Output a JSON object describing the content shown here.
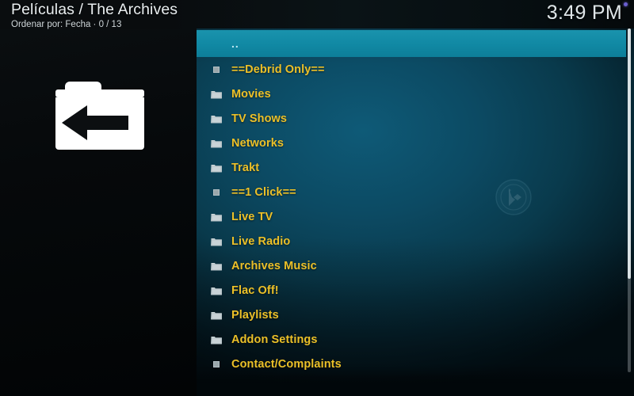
{
  "header": {
    "title": "Películas / The Archives",
    "subtitle": "Ordenar por: Fecha  ·  0 / 13",
    "clock": "3:49 PM",
    "notification_dot_color": "#6a5fd0"
  },
  "left_panel": {
    "icon_name": "parent-folder-back-icon"
  },
  "colors": {
    "highlight": "#1189a4",
    "item_text": "#ecc028",
    "selected_text": "#bfe9f4",
    "background_teal": "#0c4a63",
    "panel_dark": "#06090b"
  },
  "list": {
    "selected_index": 0,
    "items": [
      {
        "label": "..",
        "icon": "none",
        "selected": true
      },
      {
        "label": "==Debrid Only==",
        "icon": "file",
        "selected": false
      },
      {
        "label": "Movies",
        "icon": "folder",
        "selected": false
      },
      {
        "label": "TV Shows",
        "icon": "folder",
        "selected": false
      },
      {
        "label": "Networks",
        "icon": "folder",
        "selected": false
      },
      {
        "label": "Trakt",
        "icon": "folder",
        "selected": false
      },
      {
        "label": "==1 Click==",
        "icon": "file",
        "selected": false
      },
      {
        "label": "Live TV",
        "icon": "folder",
        "selected": false
      },
      {
        "label": "Live Radio",
        "icon": "folder",
        "selected": false
      },
      {
        "label": "Archives Music",
        "icon": "folder",
        "selected": false
      },
      {
        "label": "Flac Off!",
        "icon": "folder",
        "selected": false
      },
      {
        "label": "Playlists",
        "icon": "folder",
        "selected": false
      },
      {
        "label": "Addon Settings",
        "icon": "folder",
        "selected": false
      },
      {
        "label": "Contact/Complaints",
        "icon": "file",
        "selected": false
      }
    ]
  },
  "watermark": {
    "icon_name": "kodi-logo-watermark"
  },
  "scrollbar": {
    "name": "list-scrollbar"
  }
}
